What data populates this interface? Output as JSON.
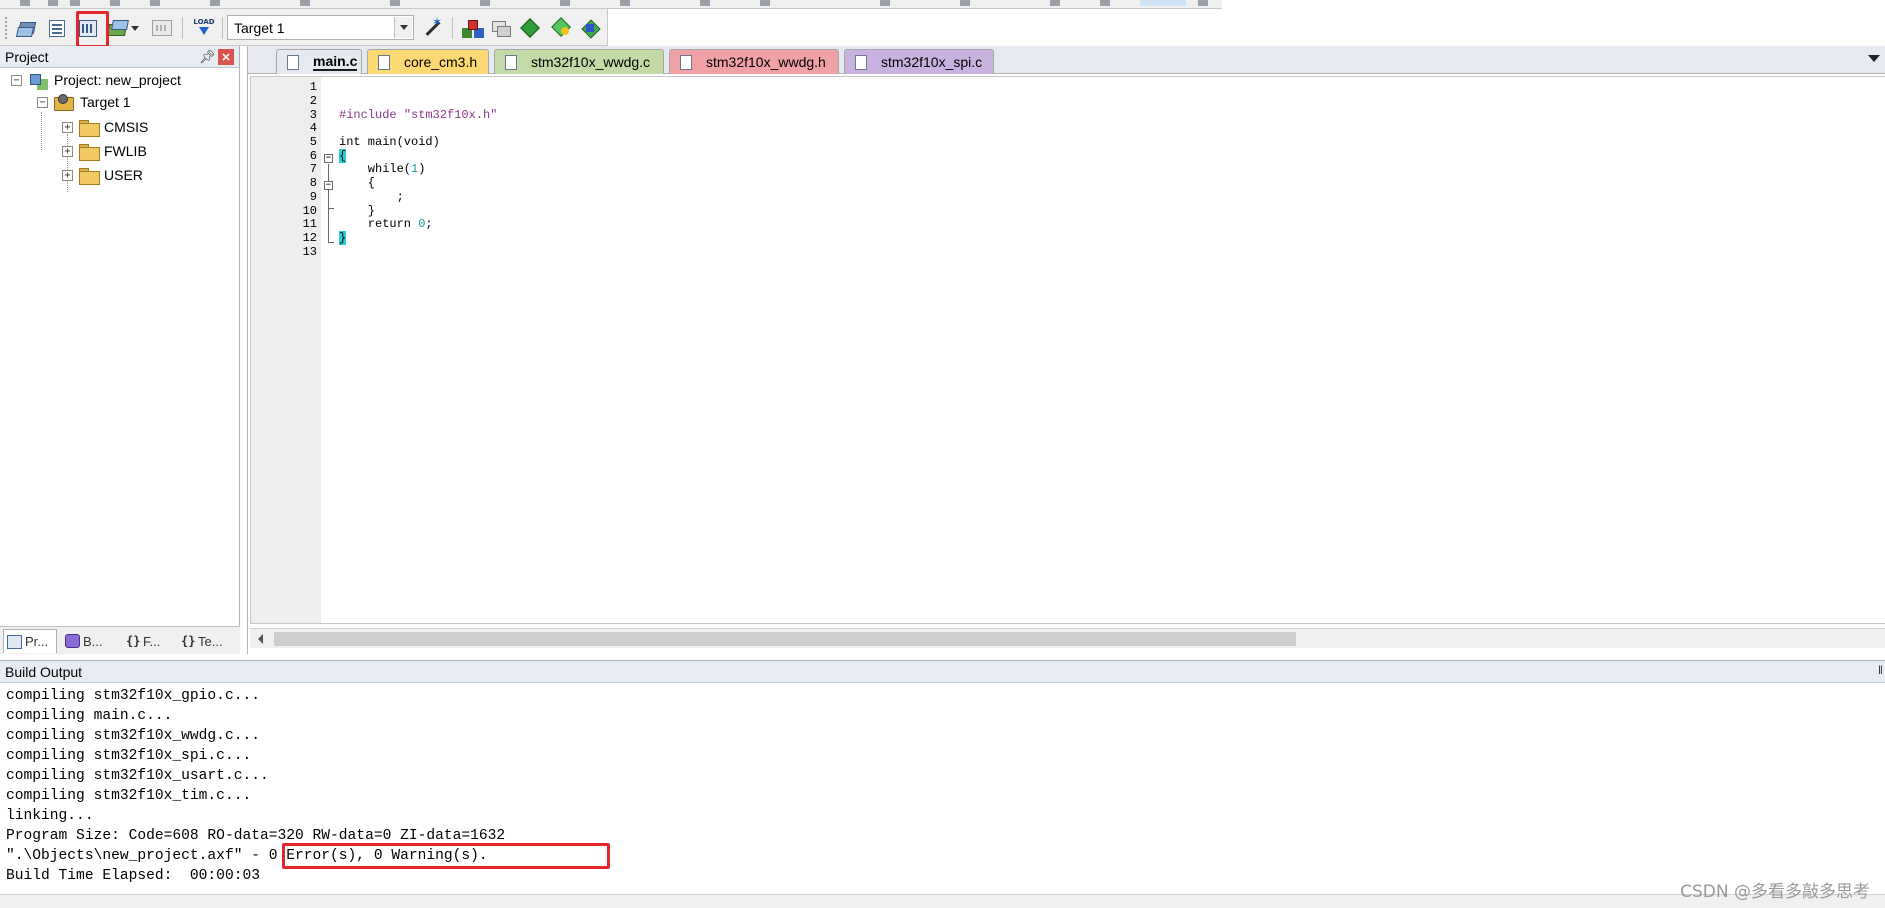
{
  "toolbar": {
    "target_value": "Target 1",
    "load_icon_text": "LOAD"
  },
  "project_panel": {
    "title": "Project",
    "tree": {
      "project_label": "Project: new_project",
      "target_label": "Target 1",
      "groups": [
        "CMSIS",
        "FWLIB",
        "USER"
      ]
    },
    "tabs": [
      "Pr...",
      "B...",
      "F...",
      "Te..."
    ]
  },
  "editor": {
    "tabs": [
      {
        "label": "main.c",
        "color": "#e6eaf0"
      },
      {
        "label": "core_cm3.h",
        "color": "#fbd871"
      },
      {
        "label": "stm32f10x_wwdg.c",
        "color": "#c3d9a6"
      },
      {
        "label": "stm32f10x_wwdg.h",
        "color": "#efa1a6"
      },
      {
        "label": "stm32f10x_spi.c",
        "color": "#c9b2e0"
      }
    ],
    "line_numbers": [
      "1",
      "2",
      "3",
      "4",
      "5",
      "6",
      "7",
      "8",
      "9",
      "10",
      "11",
      "12",
      "13"
    ],
    "code": {
      "include_kw": "#include ",
      "include_file": "\"stm32f10x.h\"",
      "main_sig": "int main(void)",
      "open_brace": "{",
      "while_kw": "    while(",
      "while_num": "1",
      "while_close": ")",
      "inner_open": "    {",
      "inner_body": "        ;",
      "inner_close": "    }",
      "return_kw": "    return ",
      "return_num": "0",
      "return_end": ";",
      "close_brace": "}"
    }
  },
  "build_output": {
    "title": "Build Output",
    "lines": [
      "compiling stm32f10x_gpio.c...",
      "compiling main.c...",
      "compiling stm32f10x_wwdg.c...",
      "compiling stm32f10x_spi.c...",
      "compiling stm32f10x_usart.c...",
      "compiling stm32f10x_tim.c...",
      "linking...",
      "Program Size: Code=608 RO-data=320 RW-data=0 ZI-data=1632",
      "\".\\Objects\\new_project.axf\" - 0 Error(s), 0 Warning(s).",
      "Build Time Elapsed:  00:00:03"
    ]
  },
  "watermark": "CSDN @多看多敲多思考",
  "colors": {
    "highlight_box": "#e4262d",
    "brace_highlight": "#28d1d1",
    "preprocessor": "#8a3a8a",
    "number": "#1a9a9a"
  }
}
